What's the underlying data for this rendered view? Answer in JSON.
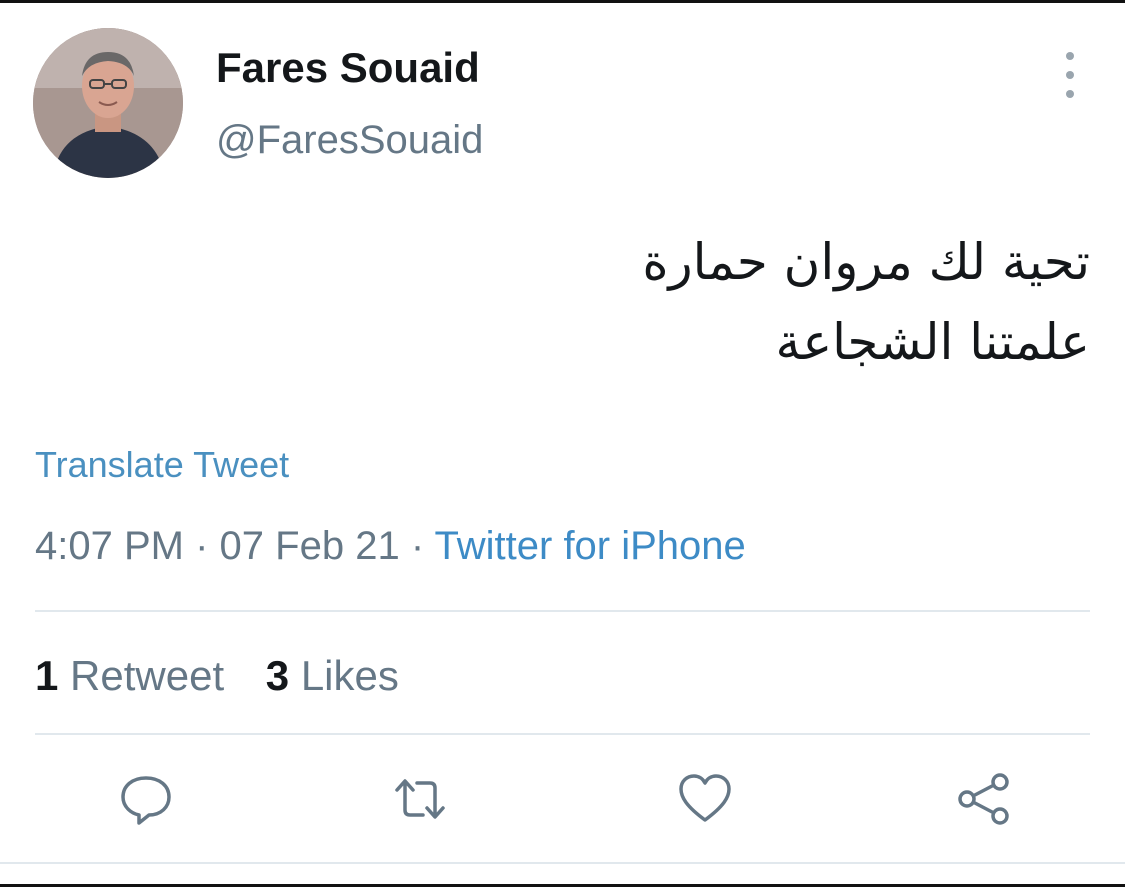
{
  "tweet": {
    "author": {
      "display_name": "Fares Souaid",
      "handle": "@FaresSouaid"
    },
    "text_lines": [
      "تحية لك مروان حمارة",
      "علمتنا الشجاعة"
    ],
    "translate_label": "Translate Tweet",
    "time": "4:07 PM",
    "separator": "·",
    "date": "07 Feb 21",
    "source": "Twitter for iPhone",
    "stats": {
      "retweets_count": "1",
      "retweets_label": "Retweet",
      "likes_count": "3",
      "likes_label": "Likes"
    },
    "actions": {
      "reply_icon": "reply-icon",
      "retweet_icon": "retweet-icon",
      "like_icon": "heart-icon",
      "share_icon": "share-icon"
    }
  },
  "colors": {
    "link": "#3d8bc6",
    "muted": "#657786",
    "text": "#14171a",
    "divider": "#e1e8ed"
  }
}
